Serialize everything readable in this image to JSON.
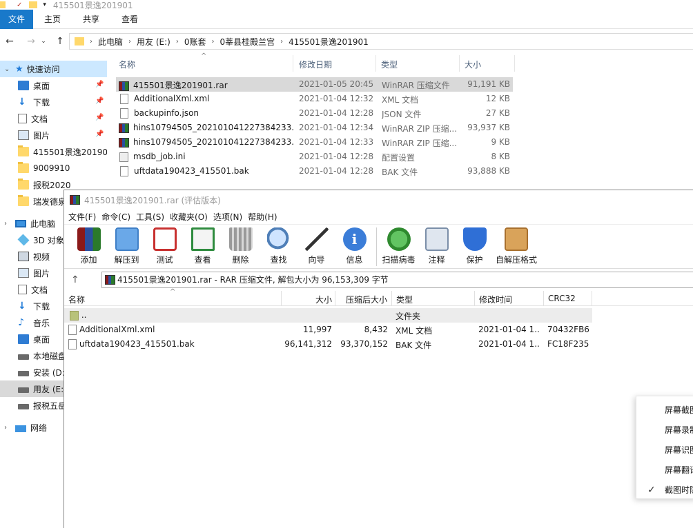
{
  "explorer": {
    "window_title": "415501景逸201901",
    "ribbon_tabs": [
      "文件",
      "主页",
      "共享",
      "查看"
    ],
    "breadcrumb": [
      "此电脑",
      "用友 (E:)",
      "0账套",
      "0莘县桂殿兰宫",
      "415501景逸201901"
    ],
    "sidebar": [
      {
        "label": "快速访问",
        "type": "star"
      },
      {
        "label": "桌面",
        "type": "bluefolder",
        "pinned": true
      },
      {
        "label": "下载",
        "type": "download",
        "pinned": true
      },
      {
        "label": "文档",
        "type": "doc",
        "pinned": true
      },
      {
        "label": "图片",
        "type": "pic",
        "pinned": true
      },
      {
        "label": "415501景逸201901",
        "type": "folder"
      },
      {
        "label": "9009910",
        "type": "folder"
      },
      {
        "label": "报税2020",
        "type": "folder"
      },
      {
        "label": "瑞发德泉",
        "type": "folder"
      },
      {
        "label": "",
        "type": "gap"
      },
      {
        "label": "此电脑",
        "type": "pc"
      },
      {
        "label": "3D 对象",
        "type": "3d"
      },
      {
        "label": "视频",
        "type": "video"
      },
      {
        "label": "图片",
        "type": "pic"
      },
      {
        "label": "文档",
        "type": "doc"
      },
      {
        "label": "下载",
        "type": "download"
      },
      {
        "label": "音乐",
        "type": "music"
      },
      {
        "label": "桌面",
        "type": "bluefolder"
      },
      {
        "label": "本地磁盘",
        "type": "drive"
      },
      {
        "label": "安装 (D:",
        "type": "drive"
      },
      {
        "label": "用友 (E:",
        "type": "drive"
      },
      {
        "label": "报税五岳",
        "type": "drive"
      },
      {
        "label": "",
        "type": "gap"
      },
      {
        "label": "网络",
        "type": "net"
      }
    ],
    "columns": {
      "name": "名称",
      "date": "修改日期",
      "type": "类型",
      "size": "大小"
    },
    "files": [
      {
        "name": "415501景逸201901.rar",
        "date": "2021-01-05 20:45",
        "type": "WinRAR 压缩文件",
        "size": "91,191 KB",
        "icon": "rar"
      },
      {
        "name": "AdditionalXml.xml",
        "date": "2021-01-04 12:32",
        "type": "XML 文档",
        "size": "12 KB",
        "icon": "doc"
      },
      {
        "name": "backupinfo.json",
        "date": "2021-01-04 12:28",
        "type": "JSON 文件",
        "size": "27 KB",
        "icon": "doc"
      },
      {
        "name": "hins10794505_202101041227384233...",
        "date": "2021-01-04 12:34",
        "type": "WinRAR ZIP 压缩...",
        "size": "93,937 KB",
        "icon": "rar"
      },
      {
        "name": "hins10794505_202101041227384233...",
        "date": "2021-01-04 12:33",
        "type": "WinRAR ZIP 压缩...",
        "size": "9 KB",
        "icon": "rar"
      },
      {
        "name": "msdb_job.ini",
        "date": "2021-01-04 12:28",
        "type": "配置设置",
        "size": "8 KB",
        "icon": "ini"
      },
      {
        "name": "uftdata190423_415501.bak",
        "date": "2021-01-04 12:28",
        "type": "BAK 文件",
        "size": "93,888 KB",
        "icon": "doc"
      }
    ]
  },
  "winrar": {
    "title": "415501景逸201901.rar (评估版本)",
    "menu": [
      "文件(F)",
      "命令(C)",
      "工具(S)",
      "收藏夹(O)",
      "选项(N)",
      "帮助(H)"
    ],
    "tools": [
      {
        "label": "添加",
        "icon": "add-icon",
        "color": "#c0392b"
      },
      {
        "label": "解压到",
        "icon": "extract-icon",
        "color": "#4a90d9"
      },
      {
        "label": "测试",
        "icon": "test-icon",
        "color": "#c8302f"
      },
      {
        "label": "查看",
        "icon": "view-icon",
        "color": "#2e8b3e"
      },
      {
        "label": "删除",
        "icon": "delete-icon",
        "color": "#8a8a8a"
      },
      {
        "label": "查找",
        "icon": "find-icon",
        "color": "#4f7fb8"
      },
      {
        "label": "向导",
        "icon": "wizard-icon",
        "color": "#444444"
      },
      {
        "label": "信息",
        "icon": "info-icon",
        "color": "#3b7dd8"
      },
      {
        "label": "扫描病毒",
        "icon": "virus-icon",
        "color": "#3a9b3a"
      },
      {
        "label": "注释",
        "icon": "comment-icon",
        "color": "#7a8ea8"
      },
      {
        "label": "保护",
        "icon": "protect-icon",
        "color": "#2f6fd6"
      },
      {
        "label": "自解压格式",
        "icon": "sfx-icon",
        "color": "#c98a3c"
      }
    ],
    "path_text": "415501景逸201901.rar - RAR 压缩文件, 解包大小为 96,153,309 字节",
    "columns": {
      "name": "名称",
      "size": "大小",
      "packed": "压缩后大小",
      "type": "类型",
      "modified": "修改时间",
      "crc": "CRC32"
    },
    "rows": [
      {
        "name": "..",
        "size": "",
        "packed": "",
        "type": "文件夹",
        "modified": "",
        "crc": "",
        "icon": "up"
      },
      {
        "name": "AdditionalXml.xml",
        "size": "11,997",
        "packed": "8,432",
        "type": "XML 文档",
        "modified": "2021-01-04 1...",
        "crc": "70432FB6",
        "icon": "doc"
      },
      {
        "name": "uftdata190423_415501.bak",
        "size": "96,141,312",
        "packed": "93,370,152",
        "type": "BAK 文件",
        "modified": "2021-01-04 1...",
        "crc": "FC18F235",
        "icon": "doc"
      }
    ]
  },
  "popup": {
    "items": [
      {
        "label": "屏幕截图",
        "checked": false
      },
      {
        "label": "屏幕录制",
        "checked": false
      },
      {
        "label": "屏幕识图",
        "checked": false
      },
      {
        "label": "屏幕翻译",
        "checked": false
      },
      {
        "label": "截图时隐",
        "checked": true
      }
    ]
  }
}
